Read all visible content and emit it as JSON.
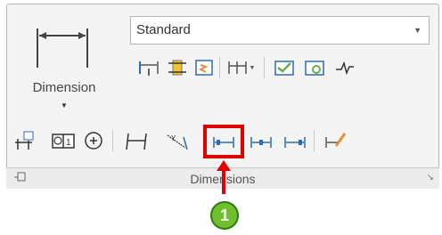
{
  "panel": {
    "big_button_label": "Dimension",
    "style_combo_value": "Standard",
    "footer_label": "Dimensions"
  },
  "callout": {
    "number": "1"
  },
  "colors": {
    "highlight": "#e00000",
    "badge": "#6fbf2f"
  }
}
